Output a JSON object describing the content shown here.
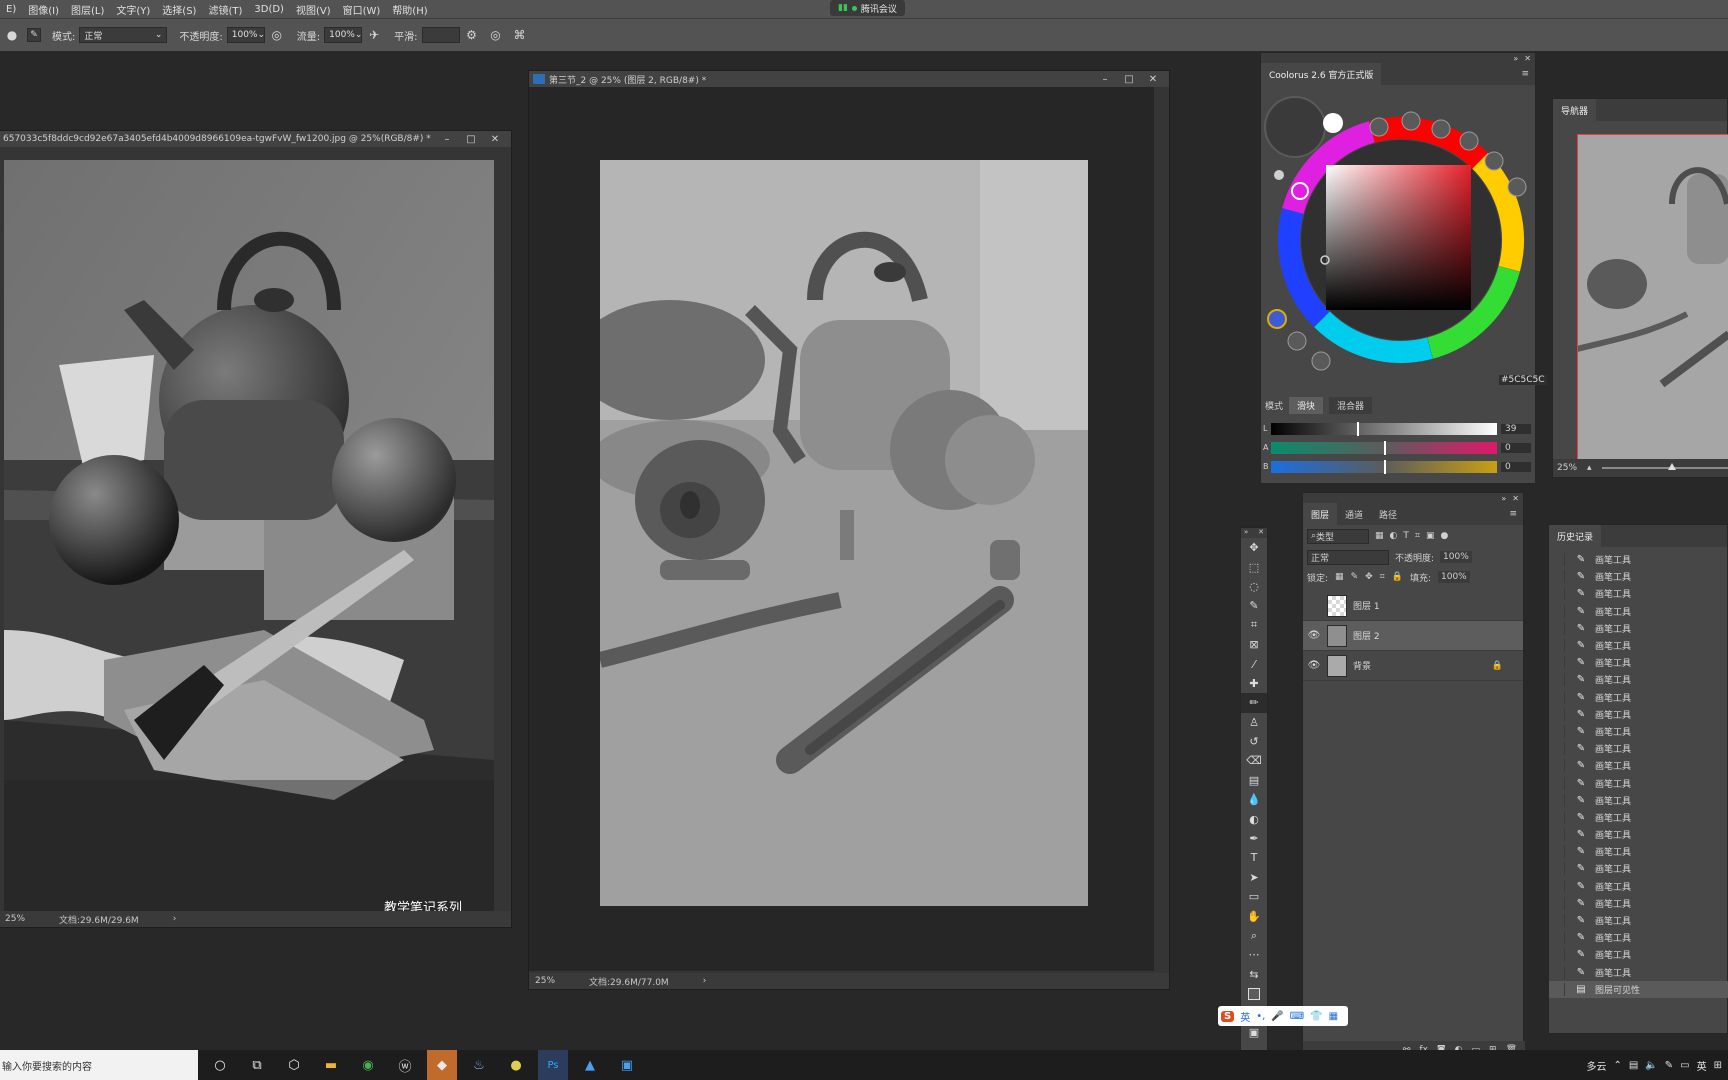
{
  "menubar": {
    "items": [
      "E)",
      "图像(I)",
      "图层(L)",
      "文字(Y)",
      "选择(S)",
      "滤镜(T)",
      "3D(D)",
      "视图(V)",
      "窗口(W)",
      "帮助(H)"
    ],
    "meeting_label": "腾讯会议"
  },
  "options": {
    "mode_label": "模式:",
    "mode_value": "正常",
    "opacity_label": "不透明度:",
    "opacity_value": "100%",
    "flow_label": "流量:",
    "flow_value": "100%",
    "smooth_label": "平滑:"
  },
  "doc_left": {
    "title": "657033c5f8ddc9cd92e67a3405efd4b4009d8966109ea-tgwFvW_fw1200.jpg @ 25%(RGB/8#) *",
    "zoom": "25%",
    "doc_info": "文档:29.6M/29.6M",
    "watermark": "教学笔记系列"
  },
  "doc_center": {
    "title": "第三节_2 @ 25% (图层 2, RGB/8#) *",
    "zoom": "25%",
    "doc_info": "文档:29.6M/77.0M"
  },
  "coolorus": {
    "title": "Coolorus 2.6 官方正式版",
    "hex": "#5C5C5C",
    "mode_label": "模式",
    "btn_slider": "滑块",
    "btn_mixer": "混合器",
    "sliders": [
      {
        "label": "L",
        "value": "39"
      },
      {
        "label": "A",
        "value": "0"
      },
      {
        "label": "B",
        "value": "0"
      }
    ]
  },
  "navigator": {
    "title": "导航器",
    "zoom": "25%"
  },
  "layers": {
    "tabs": [
      "图层",
      "通道",
      "路径"
    ],
    "filter_label": "类型",
    "blend_mode": "正常",
    "opacity_label": "不透明度:",
    "opacity_value": "100%",
    "lock_label": "锁定:",
    "fill_label": "填充:",
    "fill_value": "100%",
    "rows": [
      {
        "name": "图层 1"
      },
      {
        "name": "图层 2"
      },
      {
        "name": "背景"
      }
    ]
  },
  "history": {
    "title": "历史记录",
    "item_label": "画笔工具",
    "last_label": "图层可见性"
  },
  "ime": {
    "label": "英"
  },
  "taskbar": {
    "search_placeholder": "输入你要搜索的内容",
    "weather": "多云",
    "lang": "英"
  },
  "colors": {
    "accent": "#C06A2C",
    "app_bg": "#282828",
    "panel_bg": "#474747"
  }
}
